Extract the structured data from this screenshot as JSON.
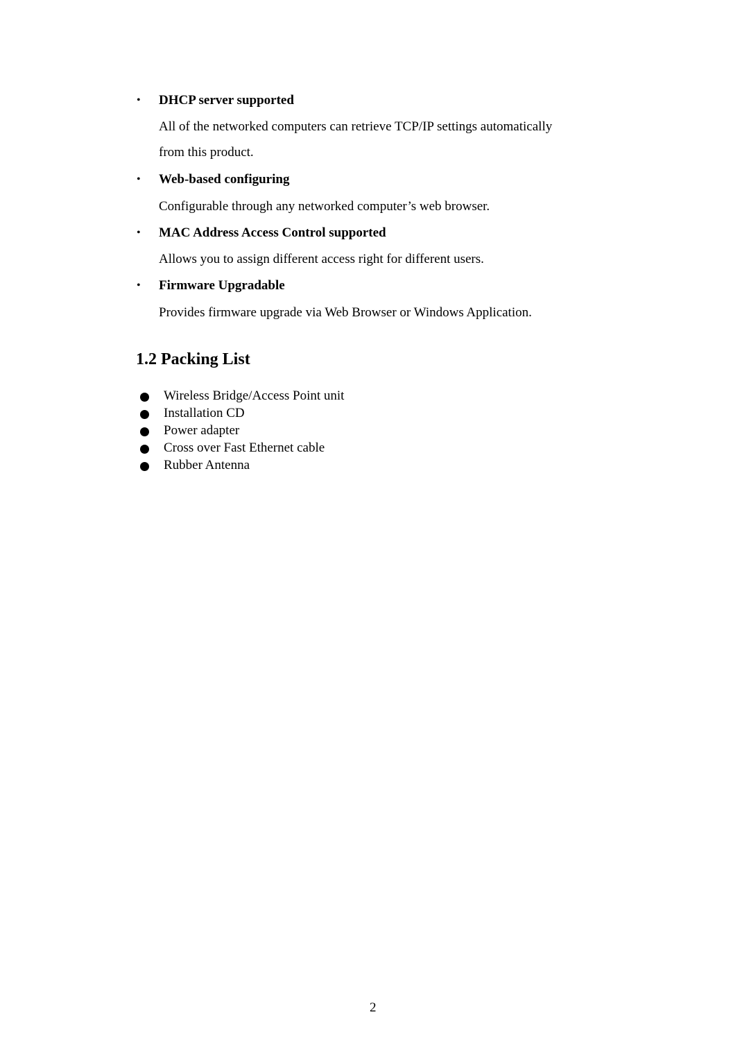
{
  "features": [
    {
      "title": "DHCP server supported",
      "description_lines": [
        "All of the networked computers can retrieve TCP/IP settings automatically",
        "from this product."
      ]
    },
    {
      "title": "Web-based configuring",
      "description_lines": [
        "Configurable through any networked computer’s web browser."
      ]
    },
    {
      "title": "MAC Address Access Control supported",
      "description_lines": [
        "Allows you to assign different access right for different users."
      ]
    },
    {
      "title": "Firmware Upgradable",
      "description_lines": [
        "Provides firmware upgrade via Web Browser or Windows Application."
      ]
    }
  ],
  "bullet_glyph": "•",
  "section": {
    "title": "1.2 Packing List"
  },
  "packing_list": [
    "Wireless Bridge/Access Point unit",
    "Installation CD",
    "Power adapter",
    "Cross over Fast Ethernet cable",
    "Rubber Antenna"
  ],
  "page_number": "2"
}
